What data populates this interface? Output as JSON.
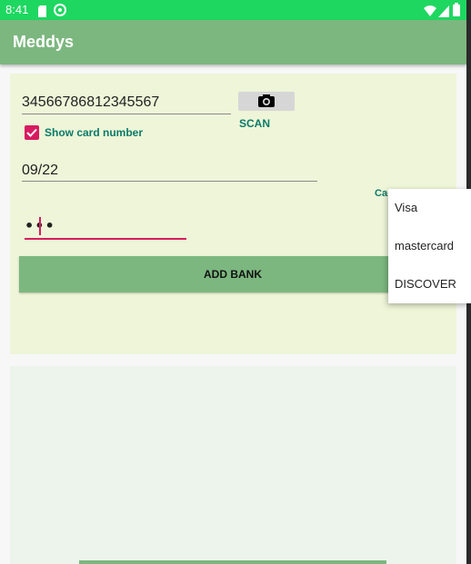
{
  "status_bar": {
    "time": "8:41"
  },
  "app_bar": {
    "title": "Meddys"
  },
  "form": {
    "card_number": "34566786812345567",
    "scan_label": "SCAN",
    "show_card_number_label": "Show card number",
    "show_card_number_checked": true,
    "expiry": "09/22",
    "card_type_label": "Ca",
    "cvv_masked": "•••",
    "add_bank_label": "ADD BANK"
  },
  "dropdown": {
    "options": [
      "Visa",
      "mastercard",
      "DISCOVER"
    ]
  },
  "colors": {
    "status_bar": "#1ed760",
    "app_bar": "#7cb77f",
    "accent": "#d81b60",
    "teal_text": "#0b7a6a"
  }
}
